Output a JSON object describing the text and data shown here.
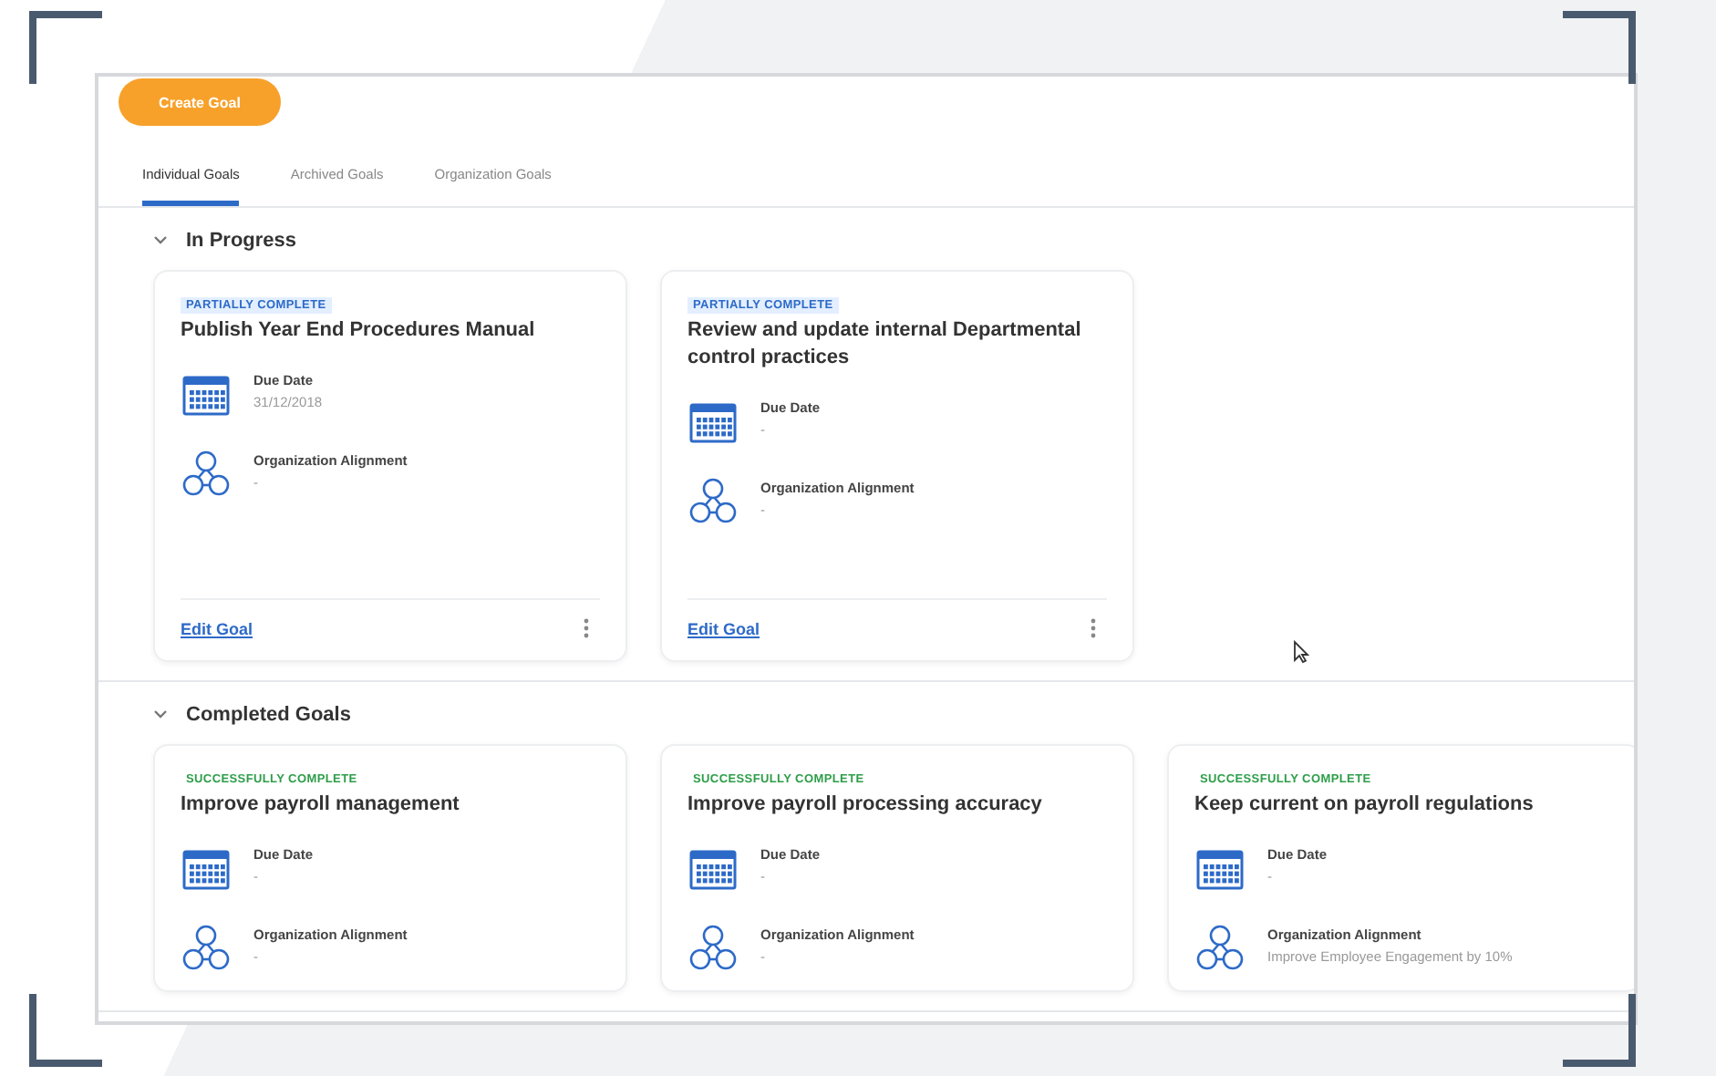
{
  "create_button": "Create Goal",
  "tabs": [
    {
      "label": "Individual Goals",
      "selected": true
    },
    {
      "label": "Archived Goals",
      "selected": false
    },
    {
      "label": "Organization Goals",
      "selected": false
    }
  ],
  "sections": [
    {
      "title": "In Progress",
      "expanded": true,
      "cards": [
        {
          "status": "PARTIALLY COMPLETE",
          "kind": "partial",
          "title": "Publish Year End Procedures Manual",
          "fields": [
            {
              "kind": "date",
              "label": "Due Date",
              "value": "31/12/2018"
            },
            {
              "kind": "alignment",
              "label": "Organization Alignment",
              "value": "-"
            }
          ],
          "action": "Edit Goal"
        },
        {
          "status": "PARTIALLY COMPLETE",
          "kind": "partial",
          "title": "Review and update internal Departmental control practices",
          "fields": [
            {
              "kind": "date",
              "label": "Due Date",
              "value": "-"
            },
            {
              "kind": "alignment",
              "label": "Organization Alignment",
              "value": "-"
            }
          ],
          "action": "Edit Goal"
        }
      ]
    },
    {
      "title": "Completed Goals",
      "expanded": true,
      "cards": [
        {
          "status": "SUCCESSFULLY COMPLETE",
          "kind": "success",
          "title": "Improve payroll management",
          "fields": [
            {
              "kind": "date",
              "label": "Due Date",
              "value": "-"
            },
            {
              "kind": "alignment",
              "label": "Organization Alignment",
              "value": "-"
            }
          ]
        },
        {
          "status": "SUCCESSFULLY COMPLETE",
          "kind": "success",
          "title": "Improve payroll processing accuracy",
          "fields": [
            {
              "kind": "date",
              "label": "Due Date",
              "value": "-"
            },
            {
              "kind": "alignment",
              "label": "Organization Alignment",
              "value": "-"
            }
          ]
        },
        {
          "status": "SUCCESSFULLY COMPLETE",
          "kind": "success",
          "title": "Keep current on payroll regulations",
          "fields": [
            {
              "kind": "date",
              "label": "Due Date",
              "value": "-"
            },
            {
              "kind": "alignment",
              "label": "Organization Alignment",
              "value": "Improve Employee Engagement by 10%"
            }
          ]
        }
      ]
    }
  ]
}
